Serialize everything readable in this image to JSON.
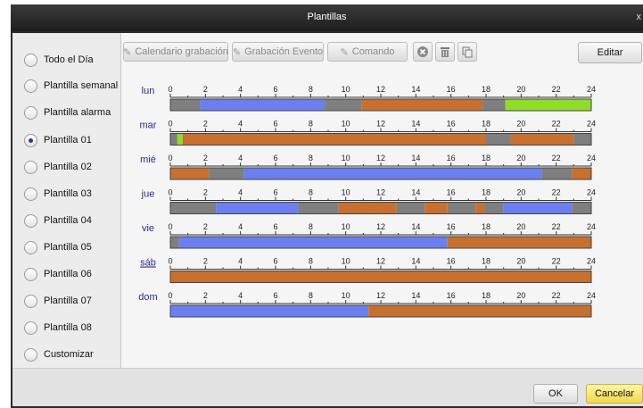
{
  "window": {
    "title": "Plantillas",
    "close_label": "x"
  },
  "templates": [
    {
      "label": "Todo el Día",
      "checked": false
    },
    {
      "label": "Plantilla semanal",
      "checked": false
    },
    {
      "label": "Plantilla alarma",
      "checked": false
    },
    {
      "label": "Plantilla 01",
      "checked": true
    },
    {
      "label": "Plantilla 02",
      "checked": false
    },
    {
      "label": "Plantilla 03",
      "checked": false
    },
    {
      "label": "Plantilla 04",
      "checked": false
    },
    {
      "label": "Plantilla 05",
      "checked": false
    },
    {
      "label": "Plantilla 06",
      "checked": false
    },
    {
      "label": "Plantilla 07",
      "checked": false
    },
    {
      "label": "Plantilla 08",
      "checked": false
    },
    {
      "label": "Customizar",
      "checked": false
    }
  ],
  "toolbar": {
    "calendario_label": "Calendario grabación",
    "evento_label": "Grabación Evento",
    "comando_label": "Comando",
    "edit_label": "Editar",
    "icons": [
      "pencil-icon",
      "clear-icon",
      "delete-icon",
      "copy-icon"
    ]
  },
  "colors": {
    "gray": "#7f7f7f",
    "blue": "#6b7ff0",
    "orange": "#c87030",
    "green": "#8fdc2a",
    "day_label": "#2a2a8a",
    "day_label_link": "#3a6fd0",
    "cancel": "#f0d94b"
  },
  "timeline": {
    "ticks": [
      "0",
      "2",
      "4",
      "6",
      "8",
      "10",
      "12",
      "14",
      "16",
      "18",
      "20",
      "22",
      "24"
    ]
  },
  "schedule": [
    {
      "day": "lun",
      "segments": [
        [
          "gray",
          0,
          1.7
        ],
        [
          "blue",
          1.7,
          8.8
        ],
        [
          "gray",
          8.8,
          10.9
        ],
        [
          "orange",
          10.9,
          17.8
        ],
        [
          "gray",
          17.8,
          19.1
        ],
        [
          "green",
          19.1,
          24
        ]
      ]
    },
    {
      "day": "mar",
      "segments": [
        [
          "gray",
          0,
          0.4
        ],
        [
          "green",
          0.4,
          0.7
        ],
        [
          "orange",
          0.7,
          18.0
        ],
        [
          "gray",
          18.0,
          19.4
        ],
        [
          "orange",
          19.4,
          23.0
        ],
        [
          "gray",
          23.0,
          24
        ]
      ]
    },
    {
      "day": "mié",
      "segments": [
        [
          "orange",
          0,
          2.2
        ],
        [
          "gray",
          2.2,
          4.2
        ],
        [
          "blue",
          4.2,
          21.2
        ],
        [
          "gray",
          21.2,
          22.9
        ],
        [
          "orange",
          22.9,
          24
        ]
      ]
    },
    {
      "day": "jue",
      "segments": [
        [
          "gray",
          0,
          2.6
        ],
        [
          "blue",
          2.6,
          7.3
        ],
        [
          "gray",
          7.3,
          9.6
        ],
        [
          "orange",
          9.6,
          12.9
        ],
        [
          "gray",
          12.9,
          14.5
        ],
        [
          "orange",
          14.5,
          15.8
        ],
        [
          "gray",
          15.8,
          17.4
        ],
        [
          "orange",
          17.4,
          17.9
        ],
        [
          "gray",
          17.9,
          19.0
        ],
        [
          "blue",
          19.0,
          22.9
        ],
        [
          "gray",
          22.9,
          24
        ]
      ]
    },
    {
      "day": "vie",
      "segments": [
        [
          "gray",
          0,
          0.5
        ],
        [
          "blue",
          0.5,
          15.8
        ],
        [
          "orange",
          15.8,
          24
        ]
      ]
    },
    {
      "day": "sáb",
      "link": true,
      "segments": [
        [
          "orange",
          0,
          24
        ]
      ]
    },
    {
      "day": "dom",
      "segments": [
        [
          "blue",
          0,
          11.3
        ],
        [
          "orange",
          11.3,
          24
        ]
      ]
    }
  ],
  "footer": {
    "ok_label": "OK",
    "cancel_label": "Cancelar"
  }
}
